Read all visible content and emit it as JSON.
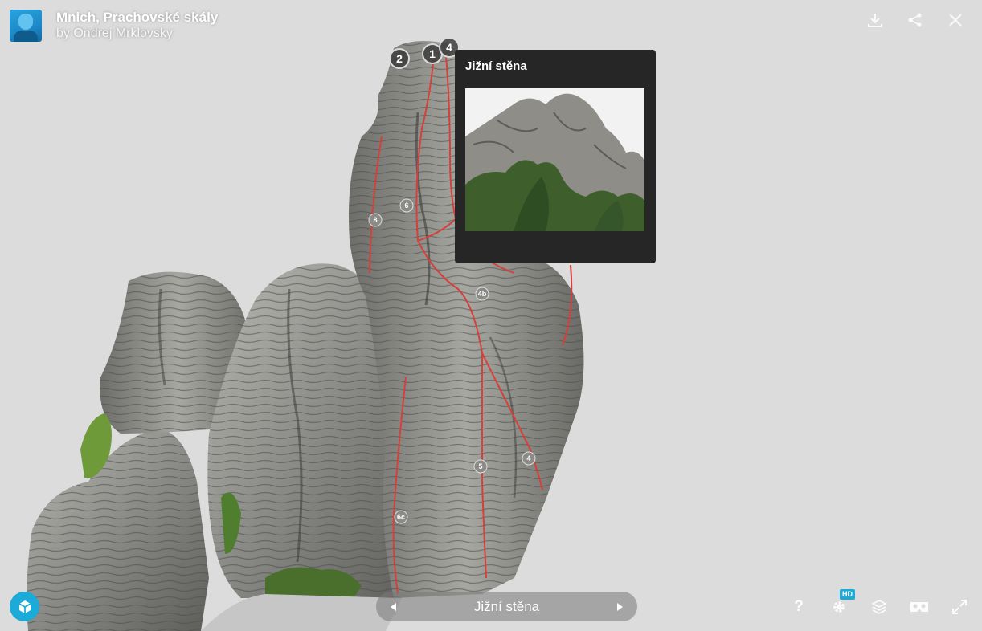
{
  "model": {
    "title": "Mnich, Prachovské skály",
    "author": "by Ondrej Mrklovsky"
  },
  "top_actions": [
    {
      "name": "download-icon"
    },
    {
      "name": "share-icon"
    },
    {
      "name": "close-icon"
    }
  ],
  "hotspots": [
    "2",
    "1",
    "4"
  ],
  "annotation": {
    "title": "Jižní stěna"
  },
  "route_markers": [
    "8",
    "6",
    "4b",
    "5",
    "4",
    "6c"
  ],
  "navigation": {
    "current": "Jižní stěna",
    "prev_icon": "triangle-left-icon",
    "next_icon": "triangle-right-icon"
  },
  "bottom_actions": [
    {
      "name": "help-icon",
      "label": "?"
    },
    {
      "name": "settings-icon",
      "badge": "HD"
    },
    {
      "name": "layers-icon"
    },
    {
      "name": "vr-icon"
    },
    {
      "name": "fullscreen-icon"
    }
  ],
  "colors": {
    "background": "#dcdcdc",
    "accent": "#1caad9",
    "tooltip_bg": "#262626",
    "route_line": "#d6403a"
  }
}
